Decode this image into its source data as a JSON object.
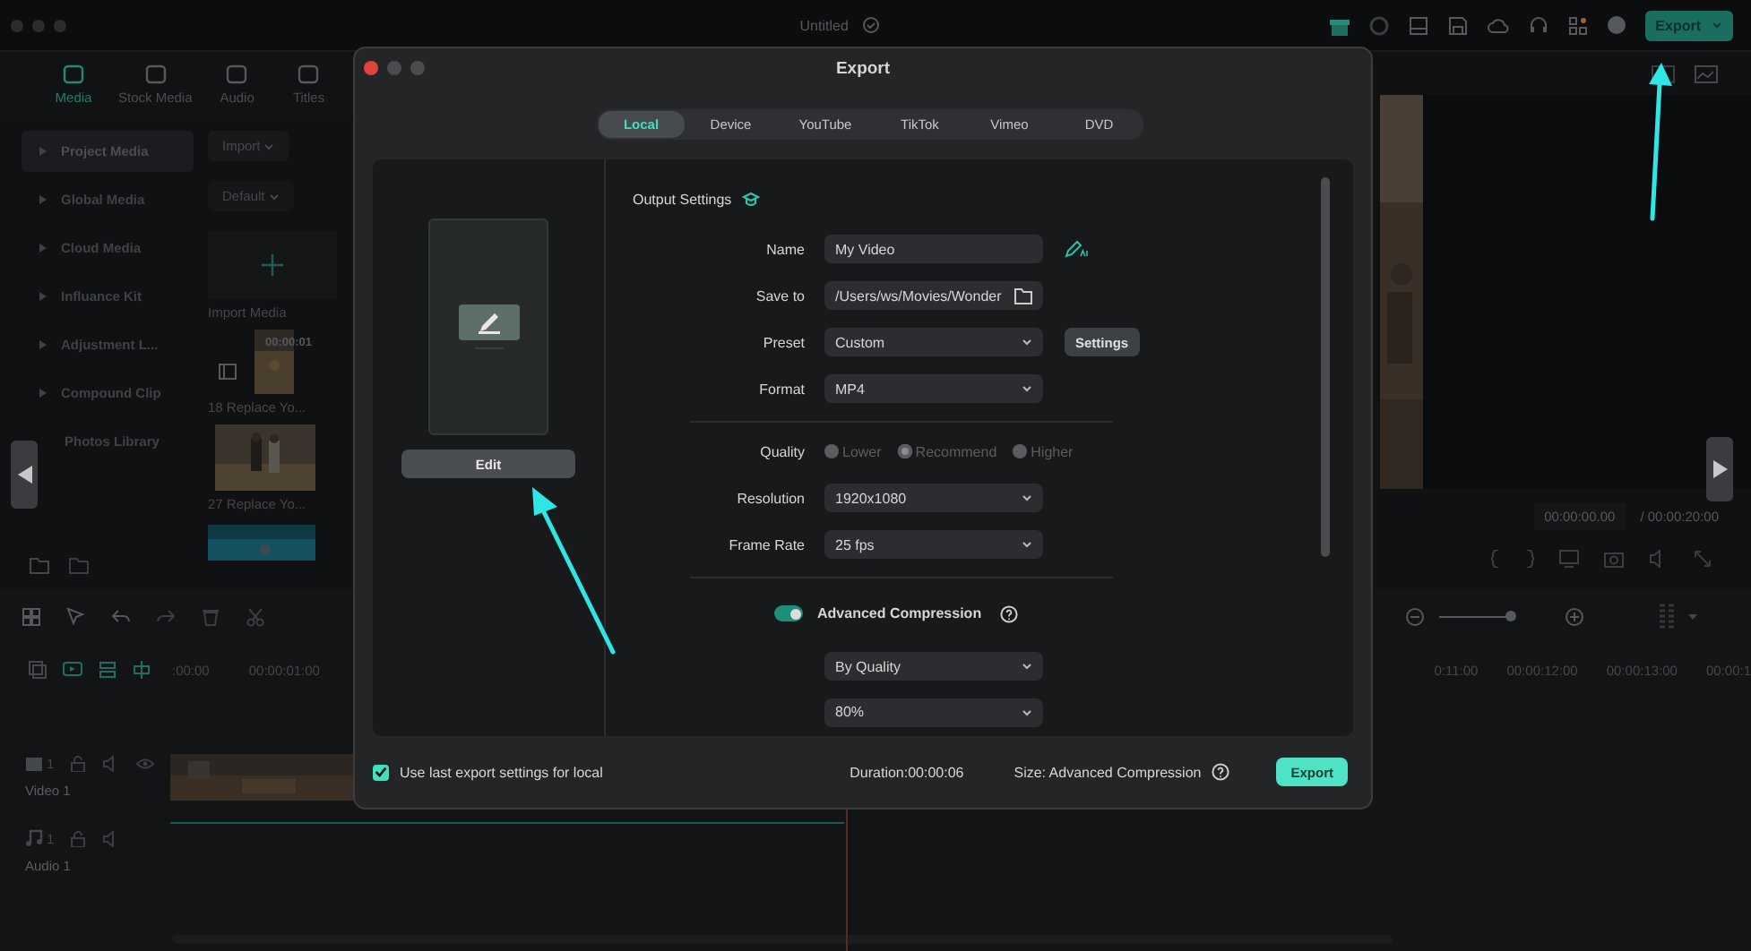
{
  "app": {
    "title": "Untitled",
    "export_button": "Export",
    "media_tabs": [
      {
        "label": "Media",
        "selected": true
      },
      {
        "label": "Stock Media",
        "selected": false
      },
      {
        "label": "Audio",
        "selected": false
      },
      {
        "label": "Titles",
        "selected": false
      }
    ],
    "sidebar": [
      {
        "label": "Project Media",
        "selected": true,
        "expandable": true
      },
      {
        "label": "Global Media",
        "selected": false,
        "expandable": true
      },
      {
        "label": "Cloud Media",
        "selected": false,
        "expandable": true
      },
      {
        "label": "Influance Kit",
        "selected": false,
        "expandable": true
      },
      {
        "label": "Adjustment L...",
        "selected": false,
        "expandable": true
      },
      {
        "label": "Compound Clip",
        "selected": false,
        "expandable": true
      },
      {
        "label": "Photos Library",
        "selected": false,
        "expandable": false
      }
    ],
    "import_button": "Import",
    "sort_button": "Default",
    "import_media": "Import Media",
    "clips": [
      {
        "name": "18 Replace Yo...",
        "duration": "00:00:01"
      },
      {
        "name": "27 Replace Yo..."
      }
    ],
    "preview": {
      "current_time": "00:00:00.00",
      "total_time": "/ 00:00:20:00"
    },
    "zoom": {
      "level": 0.65
    },
    "ruler_left": [
      ":00:00",
      "00:00:01:00"
    ],
    "ruler_right": [
      "0:11:00",
      "00:00:12:00",
      "00:00:13:00",
      "00:00:1"
    ],
    "tracks": [
      {
        "kind": "video",
        "count": "1",
        "label": "Video 1"
      },
      {
        "kind": "audio",
        "count": "1",
        "label": "Audio 1"
      }
    ]
  },
  "dialog": {
    "title": "Export",
    "tabs": [
      {
        "label": "Local",
        "selected": true
      },
      {
        "label": "Device",
        "selected": false
      },
      {
        "label": "YouTube",
        "selected": false
      },
      {
        "label": "TikTok",
        "selected": false
      },
      {
        "label": "Vimeo",
        "selected": false
      },
      {
        "label": "DVD",
        "selected": false
      }
    ],
    "edit_button": "Edit",
    "section_title": "Output Settings",
    "fields": [
      {
        "kind": "text",
        "label": "Name",
        "value": "My Video"
      },
      {
        "kind": "path",
        "label": "Save to",
        "value": "/Users/ws/Movies/Wonder"
      },
      {
        "kind": "select",
        "label": "Preset",
        "value": "Custom",
        "button": "Settings"
      },
      {
        "kind": "select",
        "label": "Format",
        "value": "MP4"
      }
    ],
    "quality": {
      "label": "Quality",
      "disabled": true,
      "options": [
        {
          "label": "Lower",
          "selected": false
        },
        {
          "label": "Recommend",
          "selected": true
        },
        {
          "label": "Higher",
          "selected": false
        }
      ]
    },
    "fields2": [
      {
        "kind": "select",
        "label": "Resolution",
        "value": "1920x1080"
      },
      {
        "kind": "select",
        "label": "Frame Rate",
        "value": "25 fps"
      }
    ],
    "compression": {
      "label": "Advanced Compression",
      "on": true,
      "options": [
        {
          "kind": "select",
          "value": "By Quality"
        },
        {
          "kind": "select",
          "value": "80%"
        }
      ]
    },
    "footer": {
      "remember": {
        "label": "Use last export settings for local",
        "checked": true
      },
      "duration": "Duration:00:00:06",
      "size": "Size: Advanced Compression",
      "export_button": "Export"
    }
  }
}
